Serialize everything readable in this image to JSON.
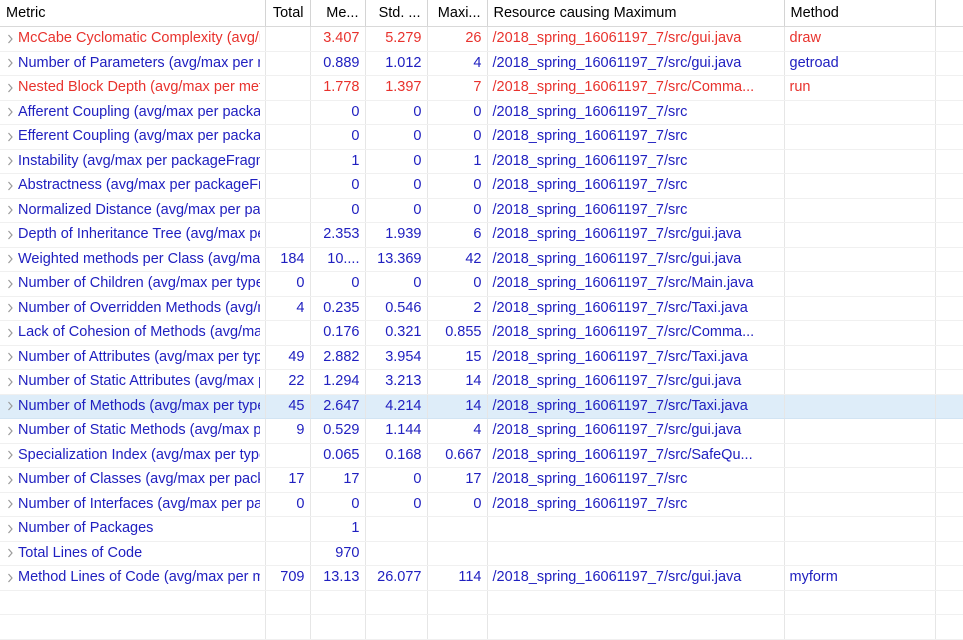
{
  "view": {
    "name": "Metrics"
  },
  "table": {
    "columns": [
      {
        "key": "metric",
        "label": "Metric",
        "align": "left"
      },
      {
        "key": "total",
        "label": "Total",
        "align": "right"
      },
      {
        "key": "mean",
        "label": "Me...",
        "align": "right"
      },
      {
        "key": "std",
        "label": "Std. ...",
        "align": "right"
      },
      {
        "key": "max",
        "label": "Maxi...",
        "align": "right"
      },
      {
        "key": "resource",
        "label": "Resource causing Maximum",
        "align": "left"
      },
      {
        "key": "method",
        "label": "Method",
        "align": "left"
      }
    ],
    "expand_icon": "chevron-right-icon",
    "selected_row_index": 15,
    "colors": {
      "red_text": "#e8322d",
      "blue_text": "#2020c0",
      "header_text": "#000000",
      "selection_background": "#deedf9",
      "grid_line": "#e6e6e6",
      "twisty": "#9a9a9a"
    },
    "rows": [
      {
        "metric": "McCabe Cyclomatic Complexity (avg/max per method)",
        "total": "",
        "mean": "3.407",
        "std": "5.279",
        "max": "26",
        "resource": "/2018_spring_16061197_7/src/gui.java",
        "method": "draw",
        "color": "red"
      },
      {
        "metric": "Number of Parameters (avg/max per method)",
        "total": "",
        "mean": "0.889",
        "std": "1.012",
        "max": "4",
        "resource": "/2018_spring_16061197_7/src/gui.java",
        "method": "getroad",
        "color": "blue"
      },
      {
        "metric": "Nested Block Depth (avg/max per method)",
        "total": "",
        "mean": "1.778",
        "std": "1.397",
        "max": "7",
        "resource": "/2018_spring_16061197_7/src/Comma...",
        "method": "run",
        "color": "red"
      },
      {
        "metric": "Afferent Coupling (avg/max per packageFragment)",
        "total": "",
        "mean": "0",
        "std": "0",
        "max": "0",
        "resource": "/2018_spring_16061197_7/src",
        "method": "",
        "color": "blue"
      },
      {
        "metric": "Efferent Coupling (avg/max per packageFragment)",
        "total": "",
        "mean": "0",
        "std": "0",
        "max": "0",
        "resource": "/2018_spring_16061197_7/src",
        "method": "",
        "color": "blue"
      },
      {
        "metric": "Instability (avg/max per packageFragment)",
        "total": "",
        "mean": "1",
        "std": "0",
        "max": "1",
        "resource": "/2018_spring_16061197_7/src",
        "method": "",
        "color": "blue"
      },
      {
        "metric": "Abstractness (avg/max per packageFragment)",
        "total": "",
        "mean": "0",
        "std": "0",
        "max": "0",
        "resource": "/2018_spring_16061197_7/src",
        "method": "",
        "color": "blue"
      },
      {
        "metric": "Normalized Distance (avg/max per packageFragment)",
        "total": "",
        "mean": "0",
        "std": "0",
        "max": "0",
        "resource": "/2018_spring_16061197_7/src",
        "method": "",
        "color": "blue"
      },
      {
        "metric": "Depth of Inheritance Tree (avg/max per type)",
        "total": "",
        "mean": "2.353",
        "std": "1.939",
        "max": "6",
        "resource": "/2018_spring_16061197_7/src/gui.java",
        "method": "",
        "color": "blue"
      },
      {
        "metric": "Weighted methods per Class (avg/max per type)",
        "total": "184",
        "mean": "10....",
        "std": "13.369",
        "max": "42",
        "resource": "/2018_spring_16061197_7/src/gui.java",
        "method": "",
        "color": "blue"
      },
      {
        "metric": "Number of Children (avg/max per type)",
        "total": "0",
        "mean": "0",
        "std": "0",
        "max": "0",
        "resource": "/2018_spring_16061197_7/src/Main.java",
        "method": "",
        "color": "blue"
      },
      {
        "metric": "Number of Overridden Methods (avg/max per type)",
        "total": "4",
        "mean": "0.235",
        "std": "0.546",
        "max": "2",
        "resource": "/2018_spring_16061197_7/src/Taxi.java",
        "method": "",
        "color": "blue"
      },
      {
        "metric": "Lack of Cohesion of Methods (avg/max per type)",
        "total": "",
        "mean": "0.176",
        "std": "0.321",
        "max": "0.855",
        "resource": "/2018_spring_16061197_7/src/Comma...",
        "method": "",
        "color": "blue"
      },
      {
        "metric": "Number of Attributes (avg/max per type)",
        "total": "49",
        "mean": "2.882",
        "std": "3.954",
        "max": "15",
        "resource": "/2018_spring_16061197_7/src/Taxi.java",
        "method": "",
        "color": "blue"
      },
      {
        "metric": "Number of Static Attributes (avg/max per type)",
        "total": "22",
        "mean": "1.294",
        "std": "3.213",
        "max": "14",
        "resource": "/2018_spring_16061197_7/src/gui.java",
        "method": "",
        "color": "blue"
      },
      {
        "metric": "Number of Methods (avg/max per type)",
        "total": "45",
        "mean": "2.647",
        "std": "4.214",
        "max": "14",
        "resource": "/2018_spring_16061197_7/src/Taxi.java",
        "method": "",
        "color": "blue"
      },
      {
        "metric": "Number of Static Methods (avg/max per type)",
        "total": "9",
        "mean": "0.529",
        "std": "1.144",
        "max": "4",
        "resource": "/2018_spring_16061197_7/src/gui.java",
        "method": "",
        "color": "blue"
      },
      {
        "metric": "Specialization Index (avg/max per type)",
        "total": "",
        "mean": "0.065",
        "std": "0.168",
        "max": "0.667",
        "resource": "/2018_spring_16061197_7/src/SafeQu...",
        "method": "",
        "color": "blue"
      },
      {
        "metric": "Number of Classes (avg/max per packageFragment)",
        "total": "17",
        "mean": "17",
        "std": "0",
        "max": "17",
        "resource": "/2018_spring_16061197_7/src",
        "method": "",
        "color": "blue"
      },
      {
        "metric": "Number of Interfaces (avg/max per packageFragment)",
        "total": "0",
        "mean": "0",
        "std": "0",
        "max": "0",
        "resource": "/2018_spring_16061197_7/src",
        "method": "",
        "color": "blue"
      },
      {
        "metric": "Number of Packages",
        "total": "",
        "mean": "1",
        "std": "",
        "max": "",
        "resource": "",
        "method": "",
        "color": "blue"
      },
      {
        "metric": "Total Lines of Code",
        "total": "",
        "mean": "970",
        "std": "",
        "max": "",
        "resource": "",
        "method": "",
        "color": "blue"
      },
      {
        "metric": "Method Lines of Code (avg/max per method)",
        "total": "709",
        "mean": "13.13",
        "std": "26.077",
        "max": "114",
        "resource": "/2018_spring_16061197_7/src/gui.java",
        "method": "myform",
        "color": "blue"
      }
    ]
  }
}
